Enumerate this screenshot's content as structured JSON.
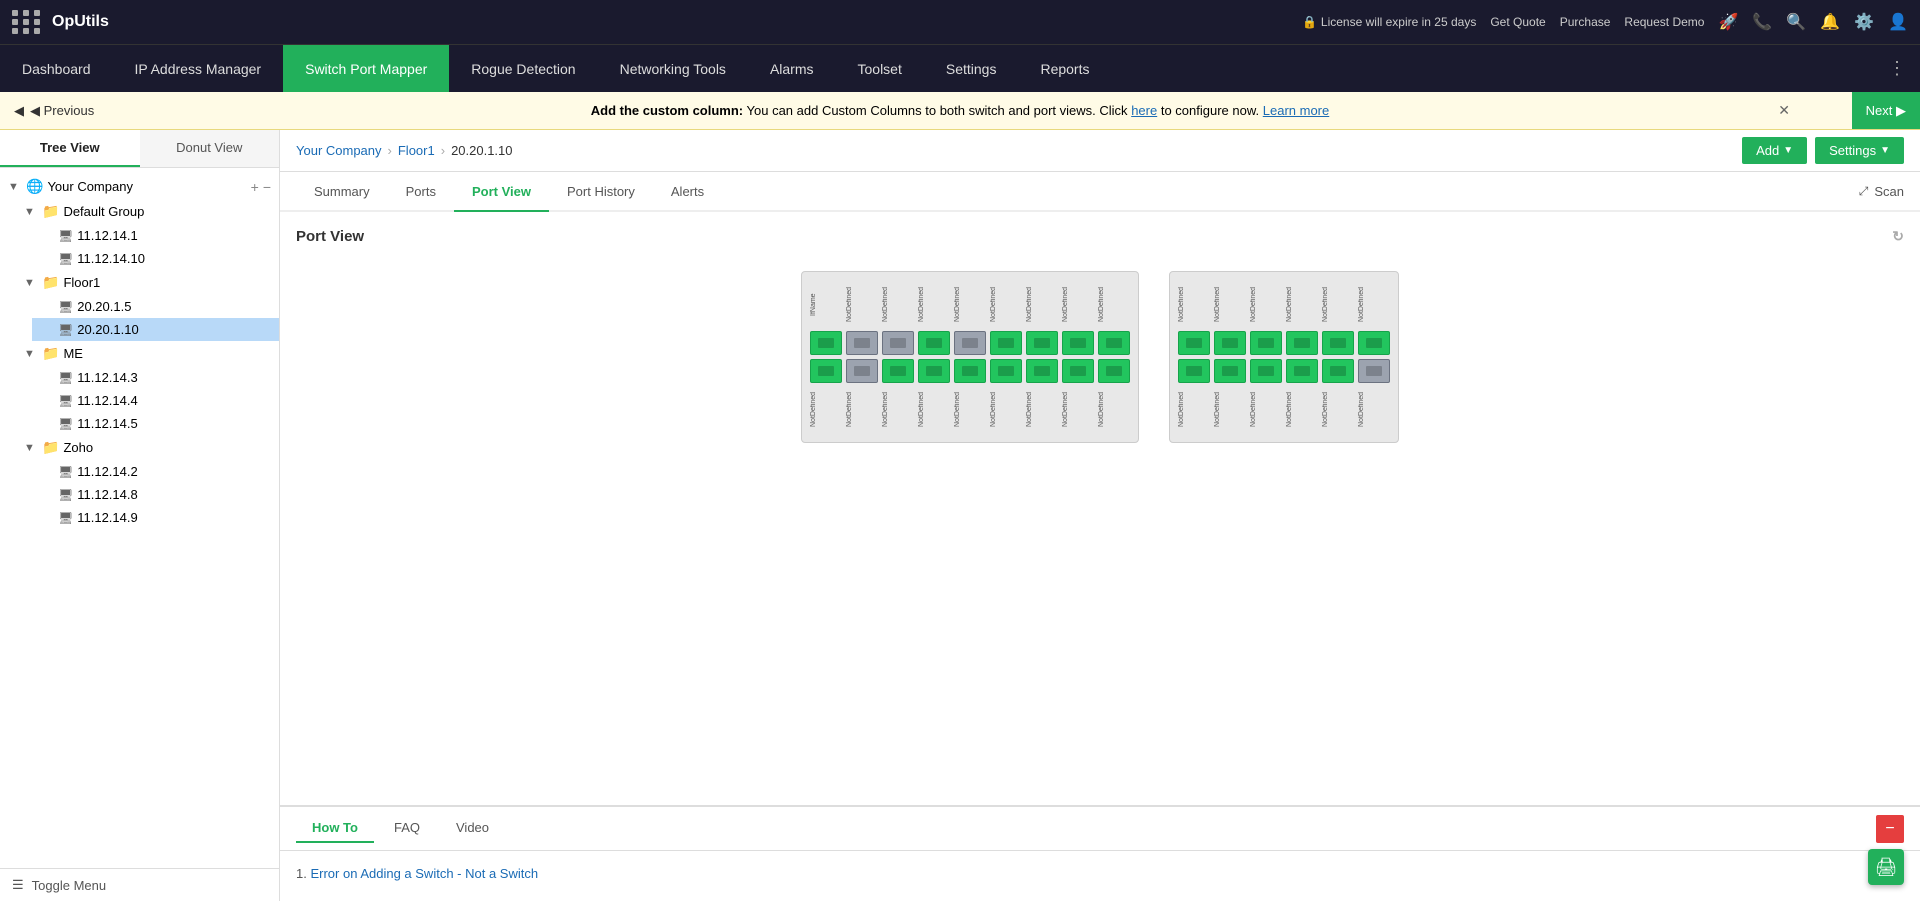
{
  "app": {
    "name": "OpUtils",
    "grid_icon": "grid-icon"
  },
  "topbar": {
    "license_text": "License will expire in 25 days",
    "get_quote": "Get Quote",
    "purchase": "Purchase",
    "request_demo": "Request Demo"
  },
  "navbar": {
    "items": [
      {
        "id": "dashboard",
        "label": "Dashboard",
        "active": false
      },
      {
        "id": "ip-address-manager",
        "label": "IP Address Manager",
        "active": false
      },
      {
        "id": "switch-port-mapper",
        "label": "Switch Port Mapper",
        "active": true
      },
      {
        "id": "rogue-detection",
        "label": "Rogue Detection",
        "active": false
      },
      {
        "id": "networking-tools",
        "label": "Networking Tools",
        "active": false
      },
      {
        "id": "alarms",
        "label": "Alarms",
        "active": false
      },
      {
        "id": "toolset",
        "label": "Toolset",
        "active": false
      },
      {
        "id": "settings",
        "label": "Settings",
        "active": false
      },
      {
        "id": "reports",
        "label": "Reports",
        "active": false
      }
    ]
  },
  "notification": {
    "prev_label": "◀ Previous",
    "next_label": "Next ▶",
    "bold_text": "Add the custom column:",
    "text": "You can add Custom Columns to both switch and port views. Click",
    "link_text": "here",
    "link_after": "to configure now.",
    "learn_more": "Learn more"
  },
  "sidebar": {
    "tab_tree": "Tree View",
    "tab_donut": "Donut View",
    "tree": {
      "root": "Your Company",
      "groups": [
        {
          "name": "Default Group",
          "items": [
            "11.12.14.1",
            "11.12.14.10"
          ]
        },
        {
          "name": "Floor1",
          "items": [
            "20.20.1.5",
            "20.20.1.10"
          ],
          "selected": "20.20.1.10"
        },
        {
          "name": "ME",
          "items": [
            "11.12.14.3",
            "11.12.14.4",
            "11.12.14.5"
          ]
        },
        {
          "name": "Zoho",
          "items": [
            "11.12.14.2",
            "11.12.14.8",
            "11.12.14.9"
          ]
        }
      ]
    },
    "toggle_menu": "Toggle Menu"
  },
  "breadcrumb": {
    "company": "Your Company",
    "folder": "Floor1",
    "current": "20.20.1.10"
  },
  "actions": {
    "add": "Add",
    "settings": "Settings"
  },
  "content_tabs": [
    {
      "id": "summary",
      "label": "Summary",
      "active": false
    },
    {
      "id": "ports",
      "label": "Ports",
      "active": false
    },
    {
      "id": "port-view",
      "label": "Port View",
      "active": true
    },
    {
      "id": "port-history",
      "label": "Port History",
      "active": false
    },
    {
      "id": "alerts",
      "label": "Alerts",
      "active": false
    }
  ],
  "scan_label": "Scan",
  "port_view": {
    "title": "Port View",
    "switch1_top_labels": [
      "IfName",
      "NotDefined",
      "NotDefined",
      "NotDefined",
      "NotDefined",
      "NotDefined",
      "NotDefined",
      "NotDefined",
      "NotDefined"
    ],
    "switch1_row1": [
      "green",
      "gray",
      "gray",
      "green",
      "gray",
      "green",
      "green",
      "green",
      "green"
    ],
    "switch1_row2": [
      "green",
      "gray",
      "green",
      "green",
      "green",
      "green",
      "green",
      "green",
      "green"
    ],
    "switch1_bottom_labels": [
      "NotDefined",
      "NotDefined",
      "NotDefined",
      "NotDefined",
      "NotDefined",
      "NotDefined",
      "NotDefined",
      "NotDefined",
      "NotDefined"
    ],
    "switch2_top_labels": [
      "NotDefined",
      "NotDefined",
      "NotDefined",
      "NotDefined",
      "NotDefined",
      "NotDefined"
    ],
    "switch2_row1": [
      "green",
      "green",
      "green",
      "green",
      "green",
      "green"
    ],
    "switch2_row2": [
      "green",
      "green",
      "green",
      "green",
      "green",
      "gray"
    ],
    "switch2_bottom_labels": [
      "NotDefined",
      "NotDefined",
      "NotDefined",
      "NotDefined",
      "NotDefined",
      "NotDefined"
    ]
  },
  "bottom_tabs": [
    {
      "id": "how-to",
      "label": "How To",
      "active": true
    },
    {
      "id": "faq",
      "label": "FAQ",
      "active": false
    },
    {
      "id": "video",
      "label": "Video",
      "active": false
    }
  ],
  "how_to_items": [
    {
      "num": "1",
      "text": "Error on Adding a Switch - Not a Switch"
    }
  ]
}
